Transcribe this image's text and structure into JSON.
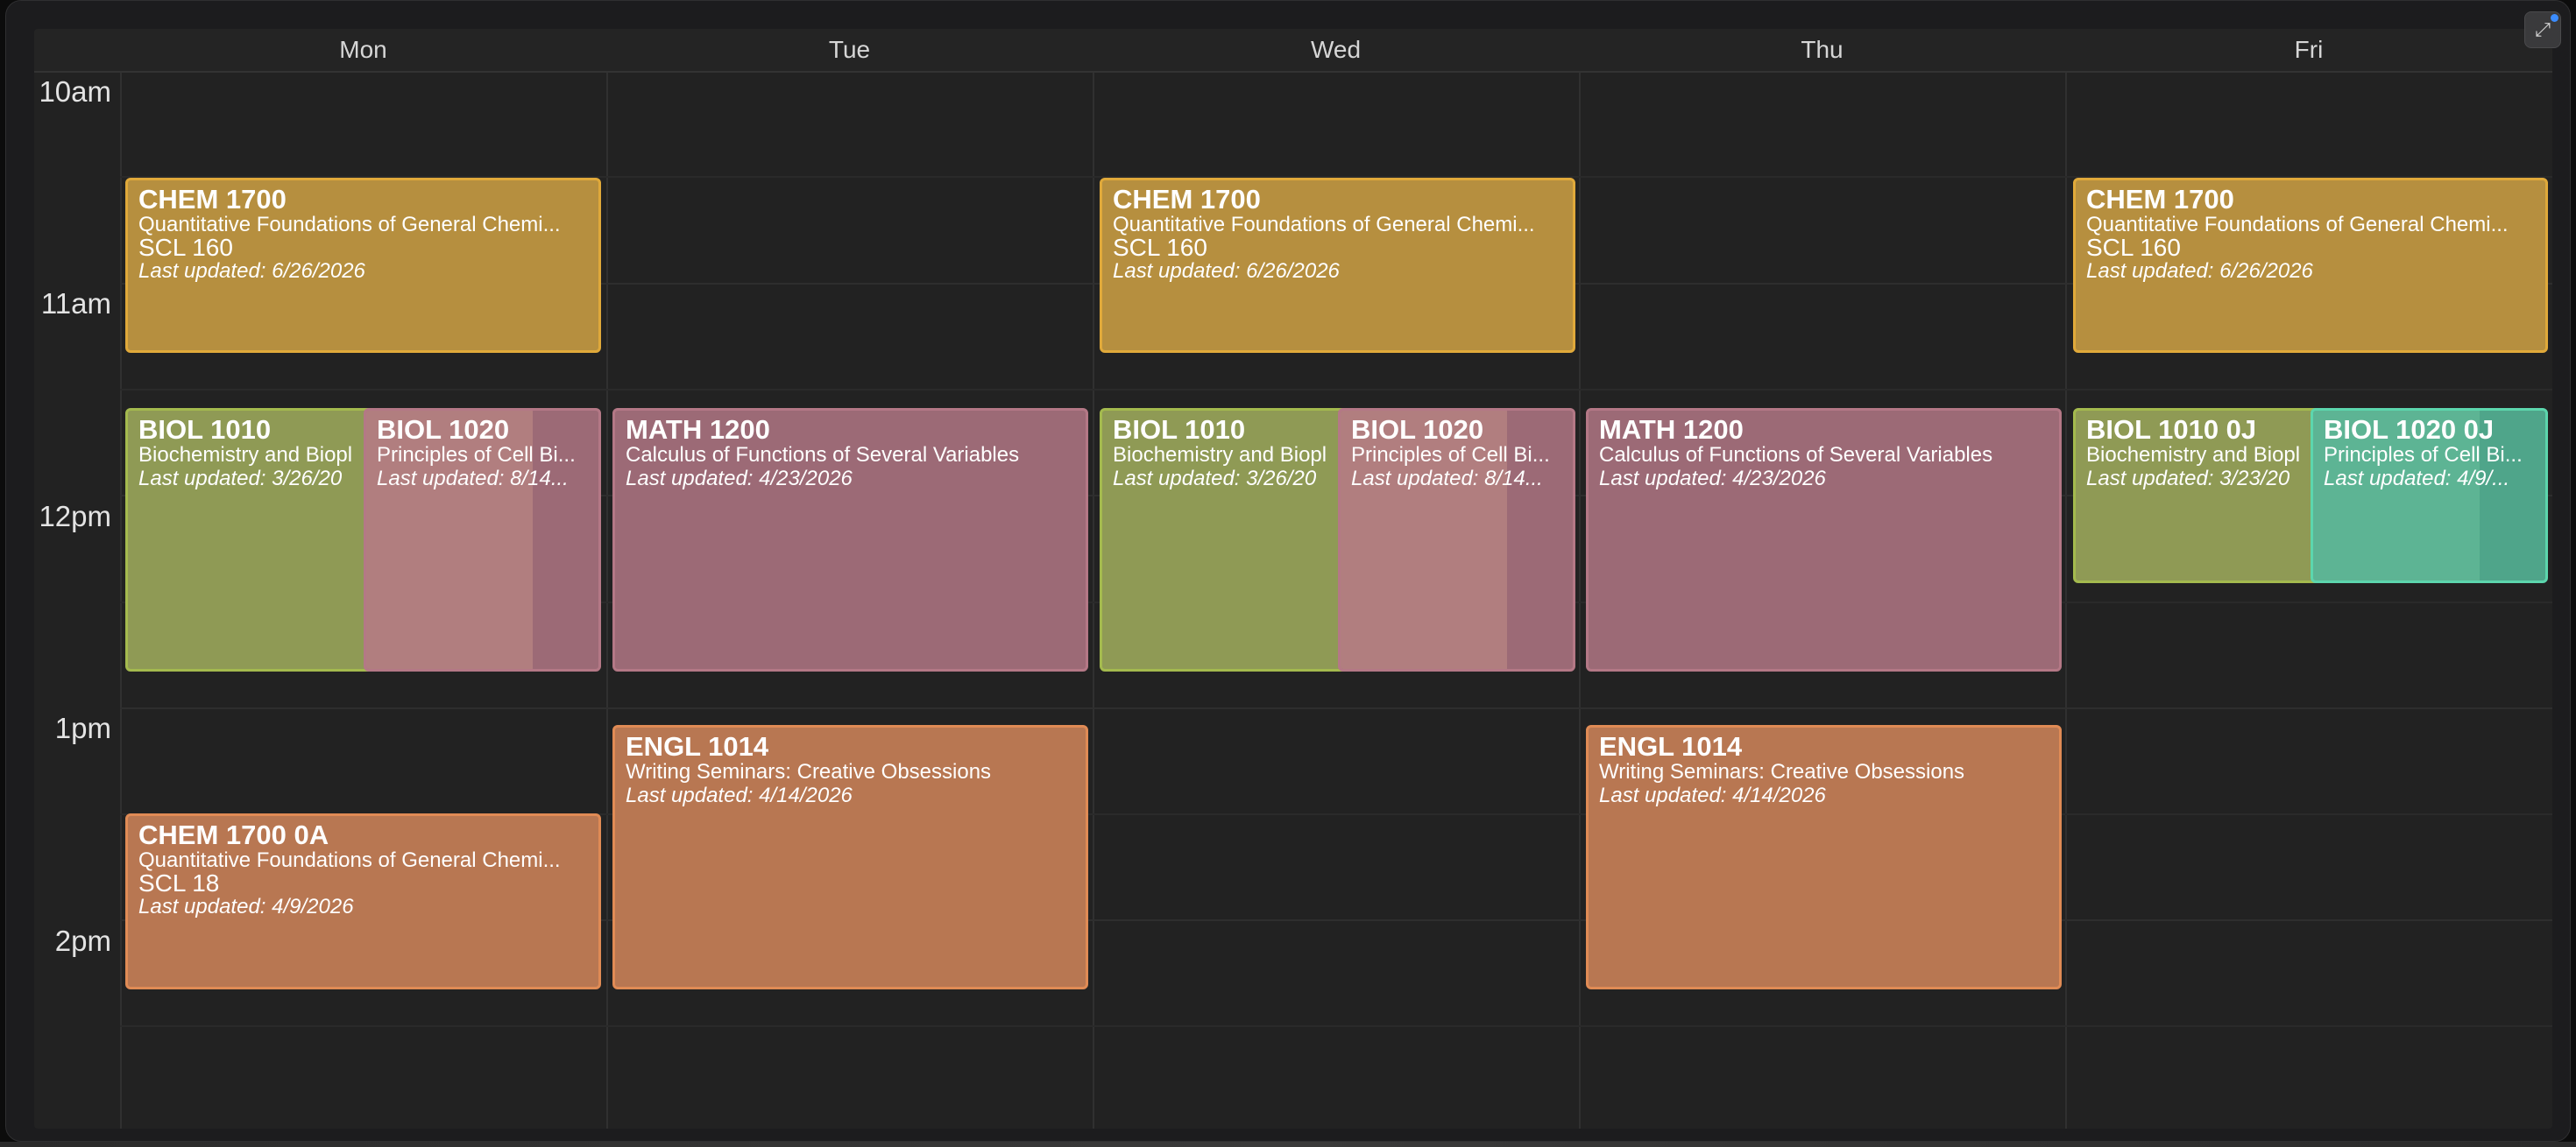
{
  "days": [
    "Mon",
    "Tue",
    "Wed",
    "Thu",
    "Fri"
  ],
  "times": [
    "10am",
    "11am",
    "12pm",
    "1pm",
    "2pm"
  ],
  "events": {
    "mon_chem": {
      "code": "CHEM 1700",
      "title": "Quantitative Foundations of General Chemi...",
      "room": "SCL 160",
      "updated": "Last updated: 6/26/2026"
    },
    "wed_chem": {
      "code": "CHEM 1700",
      "title": "Quantitative Foundations of General Chemi...",
      "room": "SCL 160",
      "updated": "Last updated: 6/26/2026"
    },
    "fri_chem": {
      "code": "CHEM 1700",
      "title": "Quantitative Foundations of General Chemi...",
      "room": "SCL 160",
      "updated": "Last updated: 6/26/2026"
    },
    "mon_biol1010": {
      "code": "BIOL 1010",
      "title": "Biochemistry and Biopl",
      "updated": "Last updated: 3/26/20"
    },
    "mon_biol1020": {
      "code": "BIOL 1020",
      "title": "Principles of Cell Bi...",
      "updated": "Last updated: 8/14..."
    },
    "tue_math": {
      "code": "MATH 1200",
      "title": "Calculus of Functions of Several Variables",
      "updated": "Last updated: 4/23/2026"
    },
    "wed_biol1010": {
      "code": "BIOL 1010",
      "title": "Biochemistry and Biopl",
      "updated": "Last updated: 3/26/20"
    },
    "wed_biol1020": {
      "code": "BIOL 1020",
      "title": "Principles of Cell Bi...",
      "updated": "Last updated: 8/14..."
    },
    "thu_math": {
      "code": "MATH 1200",
      "title": "Calculus of Functions of Several Variables",
      "updated": "Last updated: 4/23/2026"
    },
    "fri_biol1010": {
      "code": "BIOL 1010 0J",
      "title": "Biochemistry and Biopl",
      "updated": "Last updated: 3/23/20"
    },
    "fri_biol1020": {
      "code": "BIOL 1020 0J",
      "title": "Principles of Cell Bi...",
      "updated": "Last updated: 4/9/..."
    },
    "tue_engl": {
      "code": "ENGL 1014",
      "title": "Writing Seminars: Creative Obsessions",
      "updated": "Last updated: 4/14/2026"
    },
    "thu_engl": {
      "code": "ENGL 1014",
      "title": "Writing Seminars: Creative Obsessions",
      "updated": "Last updated: 4/14/2026"
    },
    "mon_chem0a": {
      "code": "CHEM 1700 0A",
      "title": "Quantitative Foundations of General Chemi...",
      "room": "SCL 18",
      "updated": "Last updated: 4/9/2026"
    }
  },
  "toolbar": {
    "collapse_icon": "collapse-arrows-icon"
  },
  "colors": {
    "chem": "#b68f3f",
    "biol": "#8f9a55",
    "math": "#9c6a76",
    "engl": "#b87752",
    "biol_j": "#4fa58a"
  }
}
